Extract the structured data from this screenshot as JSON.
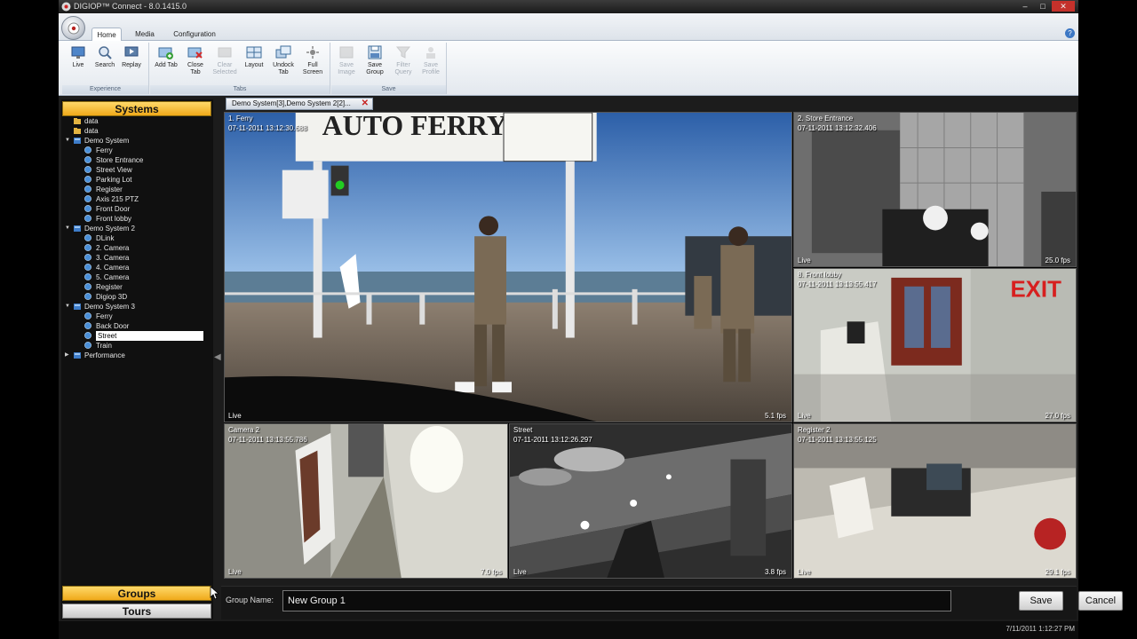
{
  "window": {
    "title": "DIGIOP™ Connect - 8.0.1415.0"
  },
  "ribbon": {
    "tabs": [
      {
        "label": "Home"
      },
      {
        "label": "Media"
      },
      {
        "label": "Configuration"
      }
    ],
    "groups": [
      {
        "label": "Experience",
        "buttons": [
          {
            "label": "Live"
          },
          {
            "label": "Search"
          },
          {
            "label": "Replay"
          }
        ]
      },
      {
        "label": "Tabs",
        "buttons": [
          {
            "label": "Add Tab"
          },
          {
            "label": "Close Tab"
          },
          {
            "label": "Clear Selected"
          },
          {
            "label": "Layout"
          },
          {
            "label": "Undock Tab"
          },
          {
            "label": "Full Screen"
          }
        ]
      },
      {
        "label": "Save",
        "buttons": [
          {
            "label": "Save Image"
          },
          {
            "label": "Save Group"
          },
          {
            "label": "Filter Query"
          },
          {
            "label": "Save Profile"
          }
        ]
      }
    ]
  },
  "sidebar": {
    "header": "Systems",
    "tree": [
      {
        "label": "data"
      },
      {
        "label": "data"
      },
      {
        "label": "Demo System",
        "children": [
          "Ferry",
          "Store Entrance",
          "Street View",
          "Parking Lot",
          "Register",
          "Axis 215 PTZ",
          "Front Door",
          "Front lobby"
        ]
      },
      {
        "label": "Demo System 2",
        "children": [
          "DLink",
          "2. Camera",
          "3. Camera",
          "4. Camera",
          "5. Camera",
          "Register",
          "Digiop 3D"
        ]
      },
      {
        "label": "Demo System 3",
        "children": [
          "Ferry",
          "Back Door",
          "Street",
          "Train"
        ]
      },
      {
        "label": "Performance"
      }
    ],
    "selected": "Street",
    "groups_label": "Groups",
    "tours_label": "Tours"
  },
  "doc_tab": {
    "label": "Demo System[3],Demo System 2[2]..."
  },
  "tiles": [
    {
      "name": "1. Ferry",
      "time": "07-11-2011 13:12:30.688",
      "status": "Live",
      "fps": "5.1 fps"
    },
    {
      "name": "2. Store Entrance",
      "time": "07-11-2011 13:12:32.406",
      "status": "Live",
      "fps": "25.0 fps"
    },
    {
      "name": "8. Front lobby",
      "time": "07-11-2011 13:13:55.417",
      "status": "Live",
      "fps": "27.0 fps"
    },
    {
      "name": "Camera 2",
      "time": "07-11-2011 13:13:55.786",
      "status": "Live",
      "fps": "7.0 fps"
    },
    {
      "name": "Street",
      "time": "07-11-2011 13:12:26.297",
      "status": "Live",
      "fps": "3.8 fps"
    },
    {
      "name": "Register 2",
      "time": "07-11-2011 13:13:55.125",
      "status": "Live",
      "fps": "29.1 fps"
    }
  ],
  "group_bar": {
    "label": "Group Name:",
    "value": "New Group 1",
    "save": "Save",
    "cancel": "Cancel"
  },
  "status": {
    "clock": "7/11/2011 1:12:27 PM"
  }
}
